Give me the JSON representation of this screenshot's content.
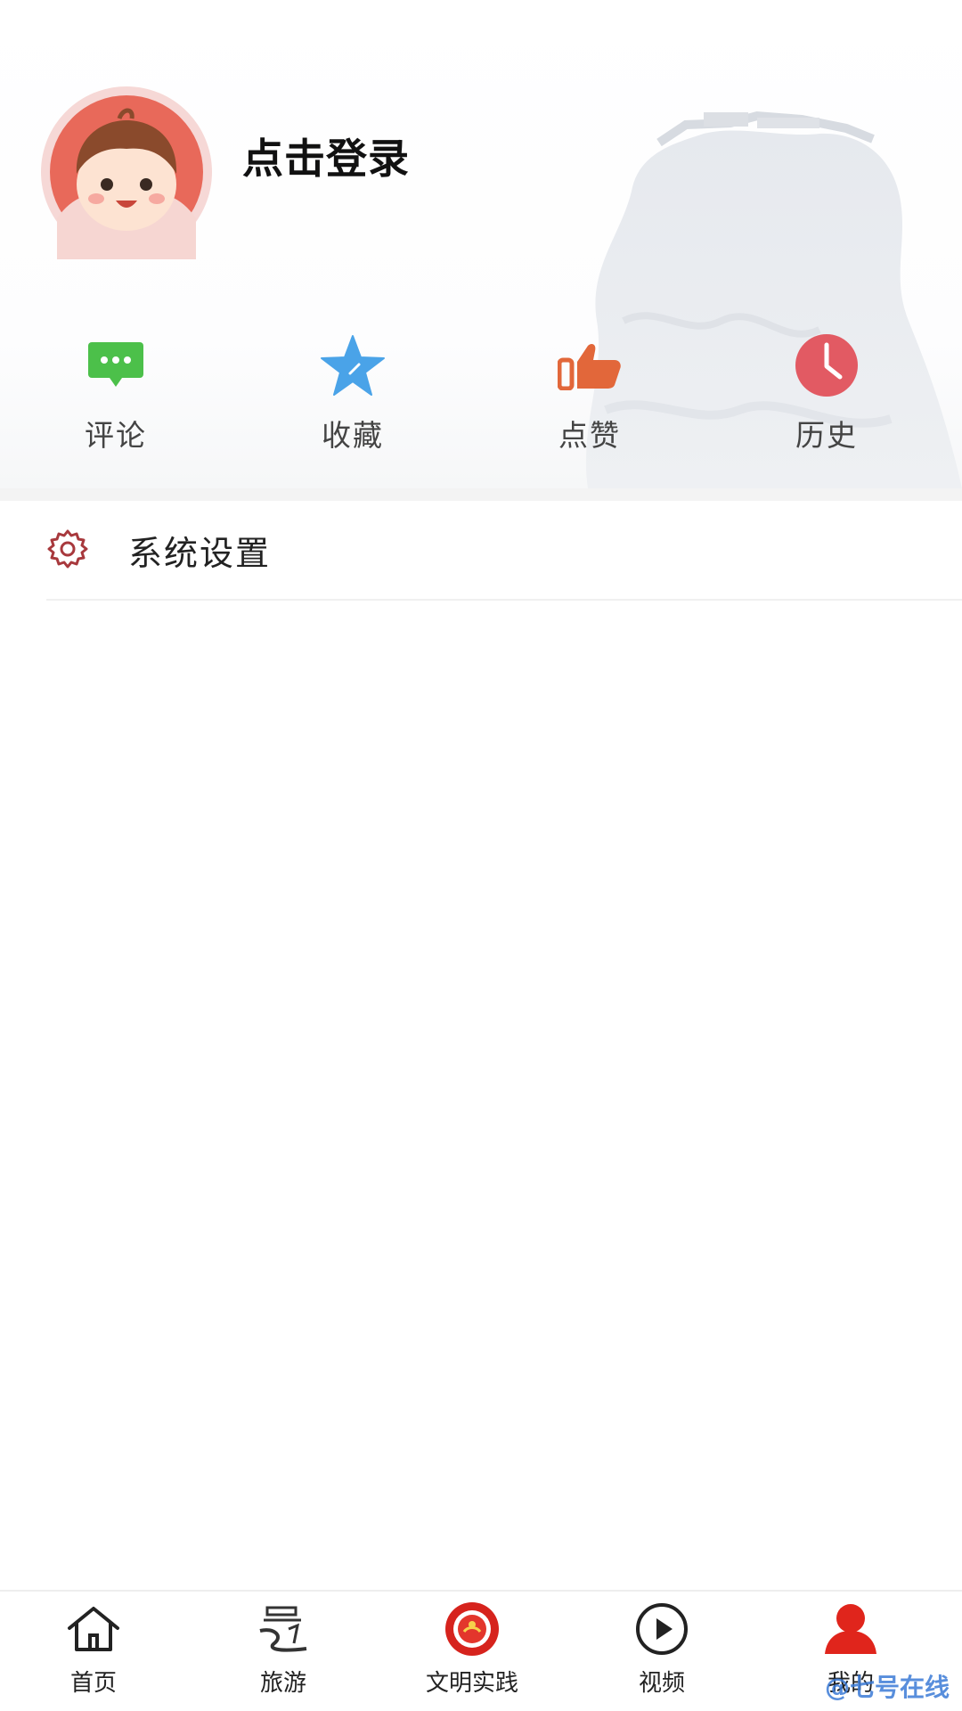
{
  "profile": {
    "login_label": "点击登录",
    "avatar_icon": "cartoon-girl-avatar"
  },
  "stats": [
    {
      "label": "评论",
      "icon": "chat-bubble-icon",
      "color": "#4cc04a"
    },
    {
      "label": "收藏",
      "icon": "star-icon",
      "color": "#4aa3e8"
    },
    {
      "label": "点赞",
      "icon": "thumbs-up-icon",
      "color": "#e2673a"
    },
    {
      "label": "历史",
      "icon": "clock-icon",
      "color": "#e25a63"
    }
  ],
  "menu": {
    "settings_label": "系统设置",
    "settings_icon": "gear-icon",
    "settings_icon_color": "#a8393d"
  },
  "nav": [
    {
      "label": "首页",
      "icon": "home-icon"
    },
    {
      "label": "旅游",
      "icon": "travel-icon"
    },
    {
      "label": "文明实践",
      "icon": "civilization-badge-icon"
    },
    {
      "label": "视频",
      "icon": "play-circle-icon"
    },
    {
      "label": "我的",
      "icon": "person-icon",
      "active": true
    }
  ],
  "colors": {
    "accent_red": "#e0251c",
    "text_dark": "#222222"
  },
  "watermark": "@七号在线"
}
